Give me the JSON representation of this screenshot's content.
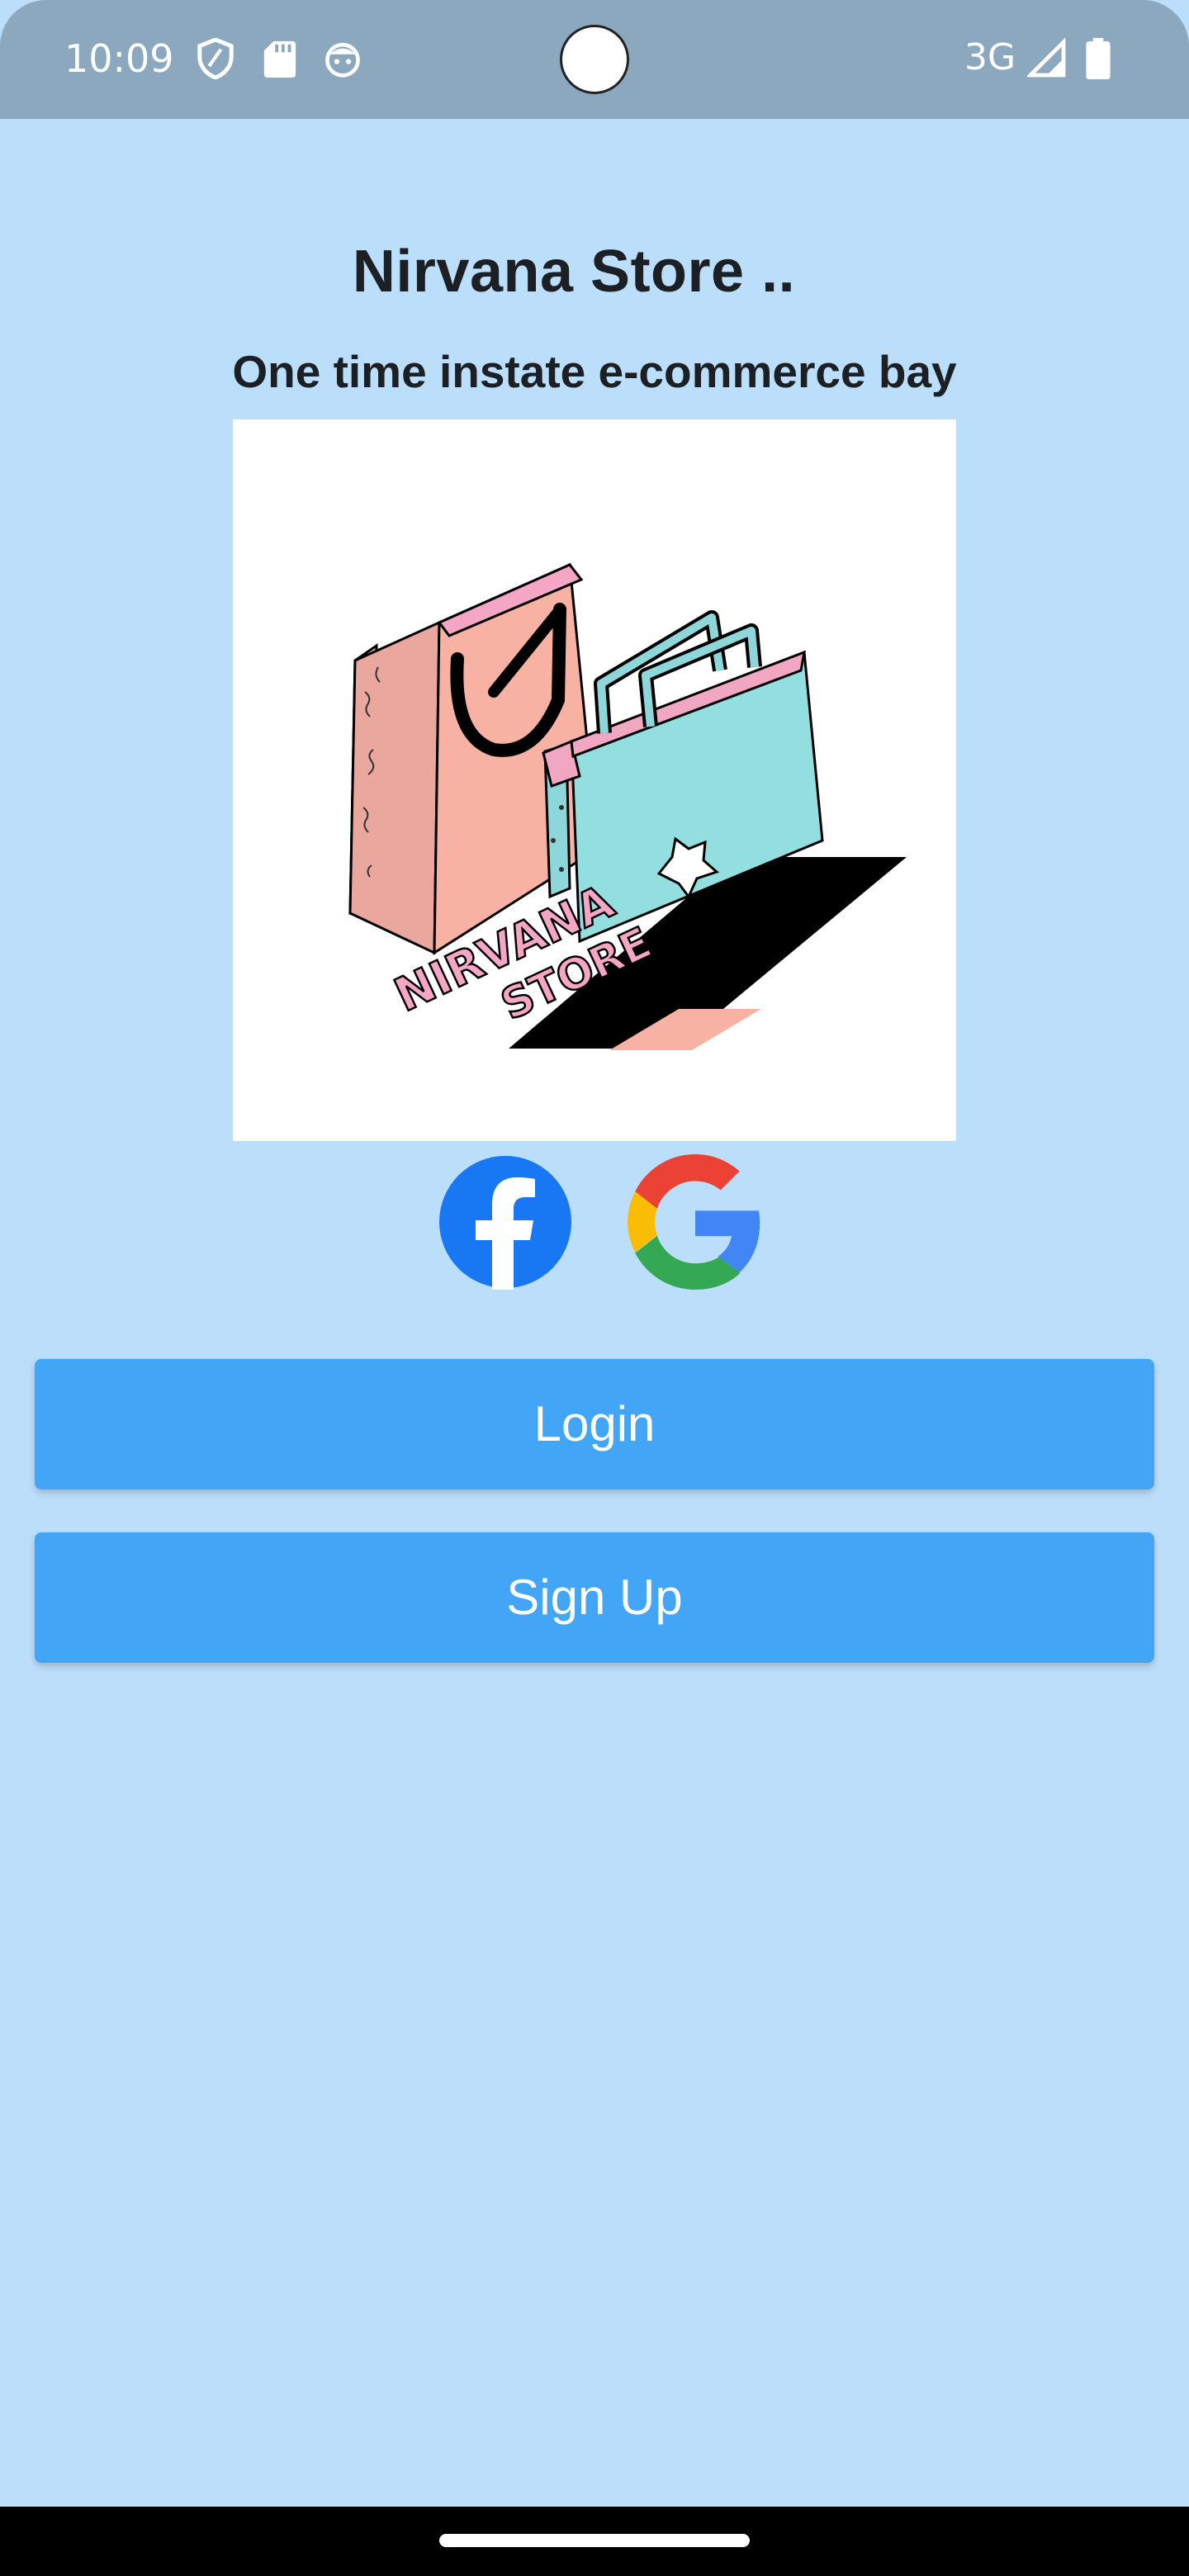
{
  "status_bar": {
    "time": "10:09",
    "network": "3G",
    "icons": [
      "shield-icon",
      "sd-card-icon",
      "face-icon",
      "signal-icon",
      "battery-icon"
    ]
  },
  "page": {
    "title": "Nirvana Store ..",
    "subtitle": "One time instate e-commerce bay",
    "logo_text_line1": "NIRVANA",
    "logo_text_line2": "STORE"
  },
  "social": {
    "facebook_icon": "facebook-icon",
    "google_icon": "google-icon"
  },
  "buttons": {
    "login": "Login",
    "signup": "Sign Up"
  },
  "colors": {
    "background": "#bbdefa",
    "status_bar": "#8ca8bf",
    "button": "#42a5f5",
    "facebook": "#1877f2"
  }
}
